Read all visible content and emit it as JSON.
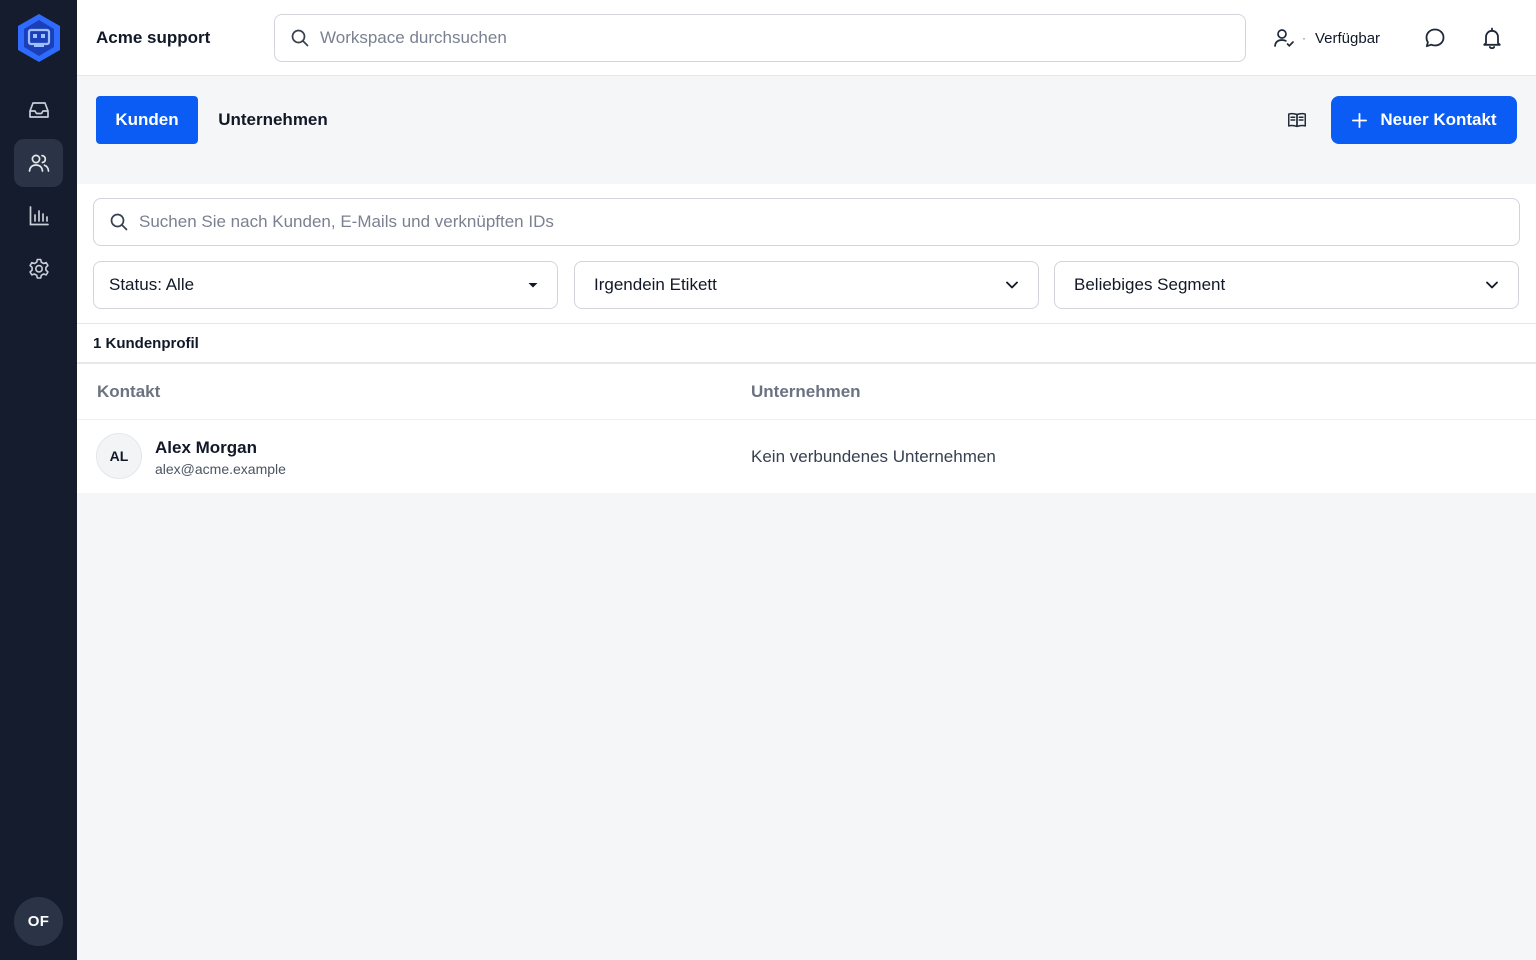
{
  "sidebar": {
    "items": [
      {
        "name": "inbox",
        "icon": "inbox-icon"
      },
      {
        "name": "contacts",
        "icon": "users-icon",
        "active": true
      },
      {
        "name": "reports",
        "icon": "bar-chart-icon"
      },
      {
        "name": "settings",
        "icon": "gear-icon"
      }
    ],
    "user_initials": "OF"
  },
  "topbar": {
    "workspace_name": "Acme support",
    "search_placeholder": "Workspace durchsuchen",
    "status_label": "Verfügbar",
    "status_separator": "·"
  },
  "tabs": [
    {
      "label": "Kunden",
      "active": true
    },
    {
      "label": "Unternehmen",
      "active": false
    }
  ],
  "actions": {
    "new_contact_label": "Neuer Kontakt"
  },
  "list": {
    "search_placeholder": "Suchen Sie nach Kunden, E-Mails und verknüpften IDs",
    "filters": {
      "status": "Status: Alle",
      "tag": "Irgendein Etikett",
      "segment": "Beliebiges Segment"
    },
    "count_label": "1 Kundenprofil",
    "columns": [
      "Kontakt",
      "Unternehmen"
    ],
    "rows": [
      {
        "initials": "AL",
        "name": "Alex Morgan",
        "email": "alex@acme.example",
        "company": "Kein verbundenes Unternehmen"
      }
    ]
  },
  "colors": {
    "sidebar_bg": "#151c2e",
    "accent": "#0b5cf5",
    "page_bg": "#f5f6f8"
  }
}
